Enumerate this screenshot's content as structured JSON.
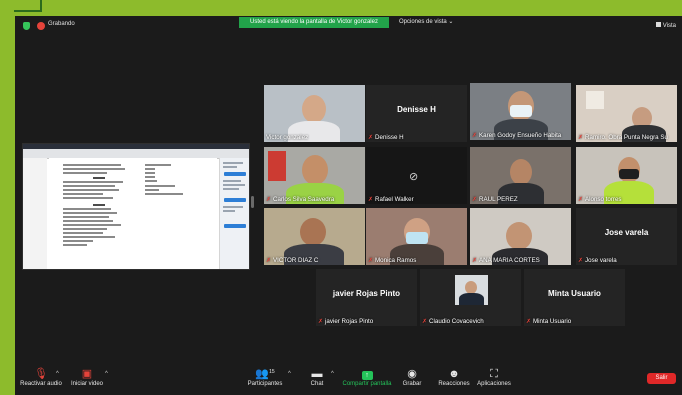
{
  "top_bar": {
    "recording_label": "Grabando",
    "banner": "Usted está viendo la pantalla de Victor gonzalez",
    "view_options": "Opciones de vista",
    "view_button": "Vista"
  },
  "participants": [
    {
      "name": "Victor gonzalez",
      "muted": false
    },
    {
      "name": "Denisse H",
      "center": "Denisse H",
      "muted": true
    },
    {
      "name": "Karen Godoy Ensueño Habita",
      "muted": true,
      "active": true
    },
    {
      "name": "Ramiro. Obra Punta Negra Su",
      "muted": true
    },
    {
      "name": "Carlos Silva Saavedra",
      "muted": true
    },
    {
      "name": "Rafael Walker",
      "muted": true
    },
    {
      "name": "RAUL PEREZ",
      "muted": true
    },
    {
      "name": "Alonso torres",
      "muted": true
    },
    {
      "name": "VICTOR DIAZ C",
      "muted": true
    },
    {
      "name": "Monica Ramos",
      "muted": true
    },
    {
      "name": "ANA MARIA CORTES",
      "muted": true
    },
    {
      "name": "Jose varela",
      "center": "Jose varela",
      "muted": true
    },
    {
      "name": "javier Rojas Pinto",
      "center": "javier Rojas Pinto",
      "muted": true
    },
    {
      "name": "Claudio Covacevich",
      "muted": true
    },
    {
      "name": "Minta Usuario",
      "center": "Minta Usuario",
      "muted": true
    }
  ],
  "toolbar": {
    "audio": "Reactivar audio",
    "video": "Iniciar video",
    "participants": "Participantes",
    "participants_count": "15",
    "chat": "Chat",
    "share": "Compartir pantalla",
    "record": "Grabar",
    "reactions": "Reacciones",
    "apps": "Aplicaciones",
    "leave": "Salir"
  },
  "colors": {
    "frame": "#8dbb2c",
    "background": "#1b1b1b",
    "banner": "#22a34a",
    "active_outline": "#d6f041",
    "leave": "#e02828",
    "muted": "#e5433a"
  }
}
